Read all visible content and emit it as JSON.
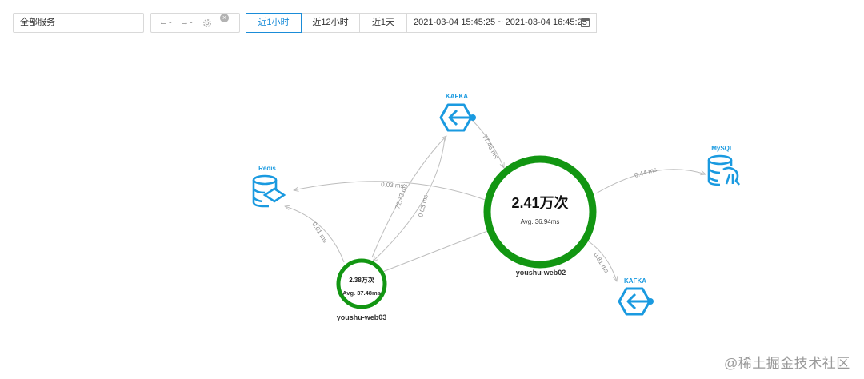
{
  "toolbar": {
    "service_select": "全部服务",
    "arrow_left": "←",
    "arrow_left_val": "-",
    "arrow_right": "→",
    "arrow_right_val": "-",
    "settings_icon": "gear-icon",
    "clear_icon": "close-circle-icon",
    "time_ranges": [
      "近1小时",
      "近12小时",
      "近1天"
    ],
    "active_range": "近1小时",
    "date_range": "2021-03-04 15:45:25 ~ 2021-03-04 16:45:25",
    "calendar_icon": "calendar-icon"
  },
  "graph": {
    "accent_color": "#1a9ae0",
    "node_ring_color": "#129612",
    "edge_color": "#bdbdbd",
    "services": {
      "web02": {
        "name": "youshu-web02",
        "count": "2.41万次",
        "avg": "Avg. 36.94ms"
      },
      "web03": {
        "name": "youshu-web03",
        "count": "2.38万次",
        "avg": "Avg. 37.48ms"
      }
    },
    "resources": {
      "kafka_top": {
        "label": "KAFKA",
        "icon": "kafka-icon"
      },
      "kafka_bottom": {
        "label": "KAFKA",
        "icon": "kafka-icon"
      },
      "redis": {
        "label": "Redis",
        "icon": "redis-icon"
      },
      "mysql": {
        "label": "MySQL",
        "icon": "mysql-icon"
      }
    },
    "edges": {
      "kafka_top_web02": "77.46 ms",
      "web02_mysql": "0.44 ms",
      "web02_redis": "0.03 ms",
      "web03_kafka_top_a": "72.72 ms",
      "web03_kafka_top_b": "0.03 ms",
      "web03_redis": "0.01 ms",
      "web02_kafka_bottom": "0.81 ms"
    }
  },
  "watermark": "@稀土掘金技术社区"
}
